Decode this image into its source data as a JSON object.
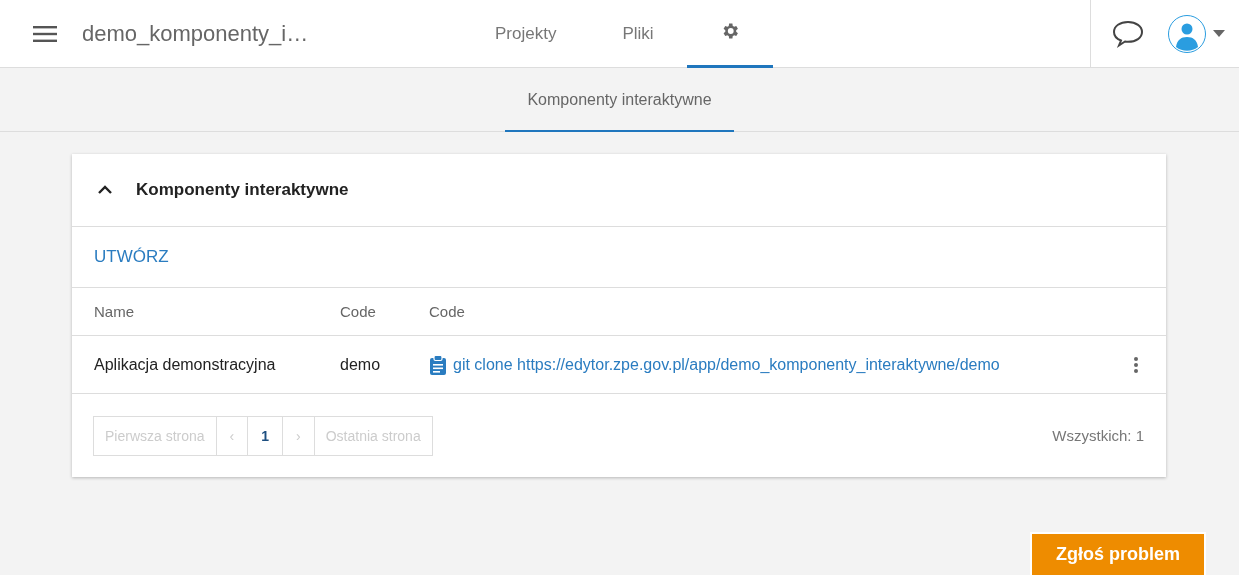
{
  "app_bar": {
    "title": "demo_komponenty_i…",
    "tabs": [
      {
        "kind": "text",
        "label": "Projekty",
        "selected": false
      },
      {
        "kind": "text",
        "label": "Pliki",
        "selected": false
      },
      {
        "kind": "settings",
        "selected": true
      }
    ]
  },
  "sub_tabs": [
    {
      "label": "Komponenty interaktywne",
      "selected": true
    }
  ],
  "panel": {
    "title": "Komponenty interaktywne",
    "expanded": true,
    "create_button": "UTWÓRZ",
    "table": {
      "columns": [
        "Name",
        "Code",
        "Code"
      ],
      "rows": [
        {
          "name": "Aplikacja demonstracyjna",
          "code": "demo",
          "clone": "git clone https://edytor.zpe.gov.pl/app/demo_komponenty_interaktywne/demo"
        }
      ]
    },
    "pagination": [
      {
        "label": "Pierwsza strona",
        "disabled": true,
        "selected": false
      },
      {
        "label": "‹",
        "disabled": true,
        "selected": false
      },
      {
        "label": "1",
        "disabled": false,
        "selected": true
      },
      {
        "label": "›",
        "disabled": true,
        "selected": false
      },
      {
        "label": "Ostatnia strona",
        "disabled": true,
        "selected": false
      }
    ],
    "total": "Wszystkich: 1"
  },
  "report_button": "Zgłoś problem"
}
